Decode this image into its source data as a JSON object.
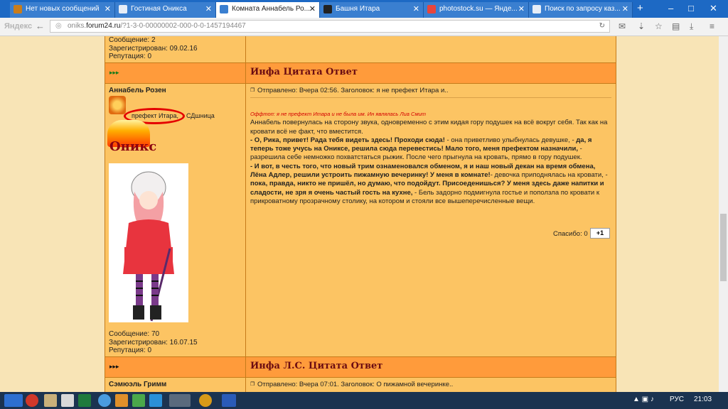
{
  "browser": {
    "tabs": [
      {
        "title": "Нет новых сообщений",
        "active": false
      },
      {
        "title": "Гостиная Оникса",
        "active": false
      },
      {
        "title": "Комната Аннабель Ро...",
        "active": true
      },
      {
        "title": "Башня Итара",
        "active": false
      },
      {
        "title": "photostock.su — Янде...",
        "active": false
      },
      {
        "title": "Поиск по запросу каз...",
        "active": false
      }
    ],
    "new_tab": "+",
    "brand": "Яндекс",
    "url_prefix": "oniks.",
    "url_domain": "forum24.ru",
    "url_path": "/?1-3-0-00000002-000-0-0-1457194467"
  },
  "forum": {
    "prev_post": {
      "messages": "Сообщение: 2",
      "registered": "Зарегистрирован: 09.02.16",
      "reputation": "Репутация: 0"
    },
    "action_bar_1": {
      "arrows": "▸▸▸",
      "links": "Инфа Цитата Ответ"
    },
    "post": {
      "author": "Аннабель Розен",
      "title_badge": "префект Итара,",
      "title_badge_suffix": "СДшница",
      "house_logo": "Оникс",
      "messages": "Сообщение: 70",
      "registered": "Зарегистрирован: 16.07.15",
      "reputation": "Репутация: 0",
      "sent": "Отправлено: Вчера 02:56. Заголовок: я не префект Итара и..",
      "offtop": "Оффтоп: я не префект Итара и не была им. Ин являлась Лиа Смит",
      "p1": "Аннабель повернулась на сторону звука, одновременно с этим кидая гору подушек на всё вокруг себя. Так как на кровати всё не факт, что вместится.",
      "p2_bold": "- О, Рика, привет! Рада тебя видеть здесь! Проходи сюда!",
      "p2_rest": " - она приветливо улыбнулась девушке, -",
      "p3_bold": " да, я теперь тоже учусь на Ониксе, решила сюда перевестись! Мало того, меня префектом назначили,",
      "p3_rest": " - разрешила себе немножко похватстаться рыжик. После чего прыгнула на кровать, прямо в гору подушек.",
      "p4_bold": "- И вот, в честь того, что новый трим ознаменовался обменом, я и наш новый декан на время обмена, Лёна Адлер, решили устроить пижамную вечеринку! У меня в комнате!",
      "p4_rest": "- девочка приподнялась на кровати, -",
      "p4_bold2": " пока, правда, никто не пришёл, но думаю, что подойдут. Присоеденишься? У меня здесь даже напитки и сладости, не зря я очень частый гость на кухне,",
      "p4_rest2": " - Бель задорно подмигнула гостье и поползла по кровати к прикроватному прозрачному столику, на котором и стояли все вышеперечисленные вещи.",
      "thanks_label": "Спасибо: 0",
      "thanks_button": "+1"
    },
    "action_bar_2": {
      "arrows": "▸▸▸",
      "links": "Инфа Л.С. Цитата Ответ"
    },
    "next_post": {
      "author": "Сэмюэль Гримм",
      "sent": "Отправлено: Вчера 07:01. Заголовок: О пижамной вечеринке.."
    }
  },
  "taskbar": {
    "lang": "РУС",
    "time": "21:03"
  },
  "colors": {
    "tabbar": "#1d69c4",
    "post_bg": "#fcc463",
    "header_row": "#ff9b3b",
    "link_text": "#6a0c12"
  }
}
